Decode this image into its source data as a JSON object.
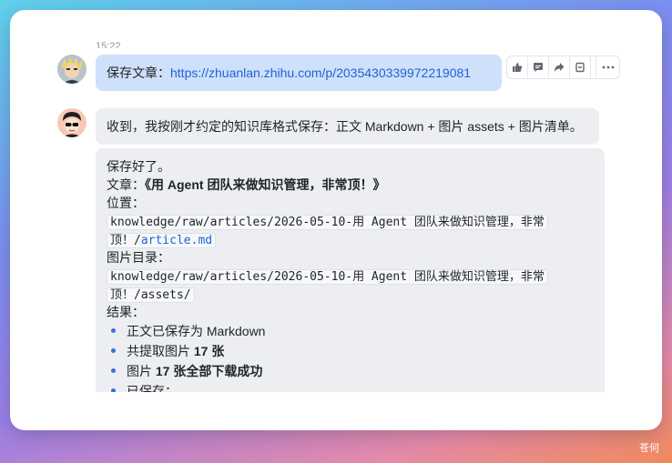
{
  "chat": {
    "timestamp": "15:22",
    "user_message": {
      "prefix": "保存文章：",
      "link": "https://zhuanlan.zhihu.com/p/2035430339972219081"
    },
    "assistant_reply_1": "收到，我按刚才约定的知识库格式保存：正文 Markdown + 图片 assets + 图片清单。",
    "assistant_reply_2": {
      "saved": "保存好了。",
      "article_label": "文章：",
      "article_title": "《用 Agent 团队来做知识管理，非常顶！》",
      "location_label": "位置：",
      "location_path_1": "knowledge/raw/articles/2026-05-10-用 Agent 团队来做知识管理，非常",
      "location_path_2_prefix": "顶！/",
      "location_path_2_link": "article.md",
      "images_label": "图片目录：",
      "images_path_1": "knowledge/raw/articles/2026-05-10-用 Agent 团队来做知识管理，非常",
      "images_path_2": "顶！/assets/",
      "result_label": "结果：",
      "results": [
        {
          "pre": "正文已保存为 Markdown",
          "bold": ""
        },
        {
          "pre": "共提取图片 ",
          "bold": "17 张"
        },
        {
          "pre": "图片 ",
          "bold": "17 张全部下载成功"
        },
        {
          "pre": "已保存：",
          "bold": ""
        }
      ]
    },
    "actions": [
      "thumbs-up",
      "comment",
      "forward",
      "delete",
      "more"
    ]
  },
  "watermark": "苍何",
  "colors": {
    "user_bubble": "#cfe0fb",
    "assistant_bubble": "#eceef1",
    "link": "#1a64d6",
    "bullet": "#3a6fe0"
  }
}
